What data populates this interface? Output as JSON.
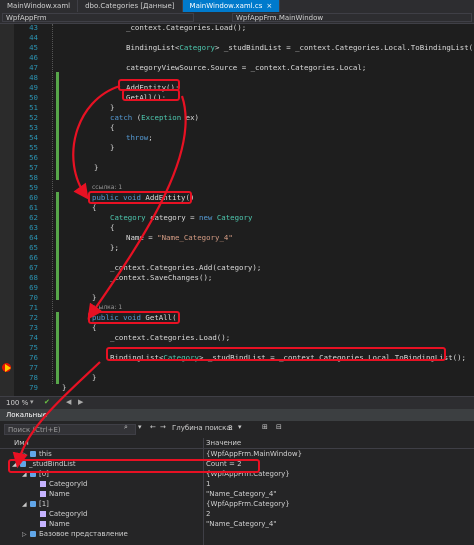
{
  "tabs": [
    {
      "label": "MainWindow.xaml",
      "active": false
    },
    {
      "label": "dbo.Categories [Данные]",
      "active": false
    },
    {
      "label": "MainWindow.xaml.cs",
      "active": true,
      "close": "×"
    }
  ],
  "nav": {
    "project": "WpfAppFrm",
    "member": "WpfAppFrm.MainWindow"
  },
  "code_lines": [
    {
      "n": "43",
      "parts": [
        [
          "_context.Categories.Load();",
          ""
        ]
      ]
    },
    {
      "n": "44",
      "parts": [
        [
          "",
          ""
        ]
      ]
    },
    {
      "n": "45",
      "parts": [
        [
          "BindingList<",
          ""
        ],
        [
          "Category",
          "ty"
        ],
        [
          "> _studBindList = _context.Categories.Local.ToBindingList();",
          ""
        ]
      ]
    },
    {
      "n": "46",
      "parts": [
        [
          "",
          ""
        ]
      ]
    },
    {
      "n": "47",
      "parts": [
        [
          "categoryViewSource.Source = _context.Categories.Local;",
          ""
        ]
      ]
    },
    {
      "n": "48",
      "parts": [
        [
          "",
          ""
        ]
      ]
    },
    {
      "n": "49",
      "parts": [
        [
          "AddEntity();",
          ""
        ]
      ]
    },
    {
      "n": "50",
      "parts": [
        [
          "GetAll();",
          ""
        ]
      ]
    },
    {
      "n": "51",
      "parts": [
        [
          "}",
          ""
        ]
      ]
    },
    {
      "n": "52",
      "parts": [
        [
          "catch",
          "kw"
        ],
        [
          " (",
          ""
        ],
        [
          "Exception",
          "ty"
        ],
        [
          " ex)",
          ""
        ]
      ]
    },
    {
      "n": "53",
      "parts": [
        [
          "{",
          ""
        ]
      ]
    },
    {
      "n": "54",
      "parts": [
        [
          "throw",
          "kw"
        ],
        [
          ";",
          ""
        ]
      ]
    },
    {
      "n": "55",
      "parts": [
        [
          "}",
          ""
        ]
      ]
    },
    {
      "n": "56",
      "parts": [
        [
          "",
          ""
        ]
      ]
    },
    {
      "n": "57",
      "parts": [
        [
          "}",
          ""
        ]
      ]
    },
    {
      "n": "58",
      "parts": [
        [
          "",
          ""
        ]
      ]
    },
    {
      "n": "59",
      "parts": [
        [
          "",
          ""
        ]
      ]
    },
    {
      "n": "60",
      "parts": [
        [
          "public",
          "kw"
        ],
        [
          " ",
          ""
        ],
        [
          "void",
          "kw"
        ],
        [
          " AddEntity()",
          ""
        ]
      ]
    },
    {
      "n": "61",
      "parts": [
        [
          "{",
          ""
        ]
      ]
    },
    {
      "n": "62",
      "parts": [
        [
          "Category",
          "ty"
        ],
        [
          " category = ",
          ""
        ],
        [
          "new",
          "kw"
        ],
        [
          " ",
          ""
        ],
        [
          "Category",
          "ty"
        ]
      ]
    },
    {
      "n": "63",
      "parts": [
        [
          "{",
          ""
        ]
      ]
    },
    {
      "n": "64",
      "parts": [
        [
          "Name = ",
          ""
        ],
        [
          "\"Name_Category_4\"",
          "st"
        ]
      ]
    },
    {
      "n": "65",
      "parts": [
        [
          "};",
          ""
        ]
      ]
    },
    {
      "n": "66",
      "parts": [
        [
          "",
          ""
        ]
      ]
    },
    {
      "n": "67",
      "parts": [
        [
          "_context.Categories.Add(category);",
          ""
        ]
      ]
    },
    {
      "n": "68",
      "parts": [
        [
          "_context.SaveChanges();",
          ""
        ]
      ]
    },
    {
      "n": "69",
      "parts": [
        [
          "",
          ""
        ]
      ]
    },
    {
      "n": "70",
      "parts": [
        [
          "}",
          ""
        ]
      ]
    },
    {
      "n": "71",
      "parts": [
        [
          "",
          ""
        ]
      ]
    },
    {
      "n": "72",
      "parts": [
        [
          "public",
          "kw"
        ],
        [
          " ",
          ""
        ],
        [
          "void",
          "kw"
        ],
        [
          " GetAll()",
          ""
        ]
      ]
    },
    {
      "n": "73",
      "parts": [
        [
          "{",
          ""
        ]
      ]
    },
    {
      "n": "74",
      "parts": [
        [
          "_context.Categories.Load();",
          ""
        ]
      ]
    },
    {
      "n": "75",
      "parts": [
        [
          "",
          ""
        ]
      ]
    },
    {
      "n": "76",
      "parts": [
        [
          "BindingList<",
          ""
        ],
        [
          "Category",
          "ty"
        ],
        [
          "> _studBindList = _context.Categories.Local.ToBindingList();",
          ""
        ]
      ]
    },
    {
      "n": "77",
      "parts": [
        [
          "",
          ""
        ]
      ]
    },
    {
      "n": "78",
      "parts": [
        [
          "}",
          ""
        ]
      ]
    },
    {
      "n": "79",
      "parts": [
        [
          "}",
          ""
        ]
      ]
    }
  ],
  "codelens": {
    "ref1": "ссылка: 1",
    "ref2": "ссылка: 1"
  },
  "editor_status": {
    "zoom": "100 %"
  },
  "locals": {
    "title": "Локальные",
    "search_placeholder": "Поиск (Ctrl+E)",
    "depth_label": "Глубина поиска:",
    "depth_value": "3",
    "col_name": "Имя",
    "col_value": "Значение",
    "rows": [
      {
        "name": "this",
        "value": "{WpfAppFrm.MainWindow}",
        "indent": 1,
        "arrow": "▷"
      },
      {
        "name": "_studBindList",
        "value": "Count = 2",
        "indent": 0,
        "arrow": "◢"
      },
      {
        "name": "[0]",
        "value": "{WpfAppFrm.Category}",
        "indent": 1,
        "arrow": "◢"
      },
      {
        "name": "CategoryId",
        "value": "1",
        "indent": 2,
        "arrow": ""
      },
      {
        "name": "Name",
        "value": "\"Name_Category_4\"",
        "indent": 2,
        "arrow": ""
      },
      {
        "name": "[1]",
        "value": "{WpfAppFrm.Category}",
        "indent": 1,
        "arrow": "◢"
      },
      {
        "name": "CategoryId",
        "value": "2",
        "indent": 2,
        "arrow": ""
      },
      {
        "name": "Name",
        "value": "\"Name_Category_4\"",
        "indent": 2,
        "arrow": ""
      },
      {
        "name": "Базовое представление",
        "value": "",
        "indent": 1,
        "arrow": "▷"
      }
    ]
  },
  "colors": {
    "annotation": "#e81123",
    "accent": "#007acc",
    "editor_bg": "#1e1e1e"
  }
}
